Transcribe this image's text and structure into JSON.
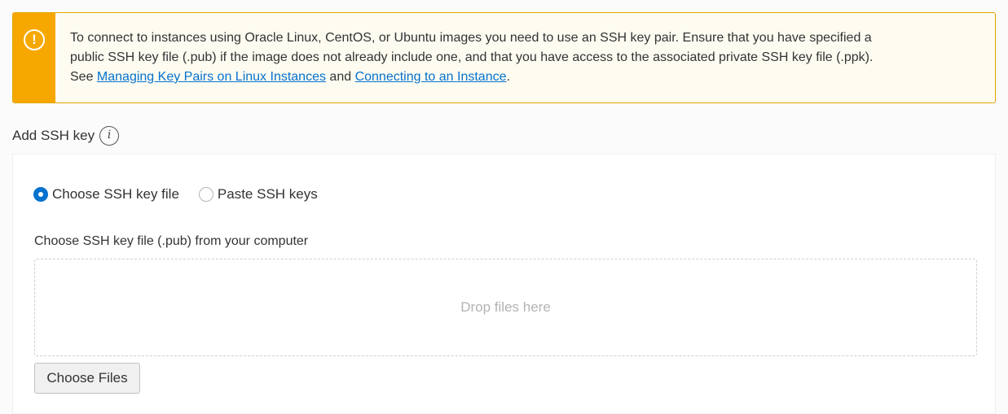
{
  "notice": {
    "icon": "warning-circle-icon",
    "line1": "To connect to instances using Oracle Linux, CentOS, or Ubuntu images you need to use an SSH key pair. Ensure that you have specified a",
    "line2": "public SSH key file (.pub) if the image does not already include one, and that you have access to the associated private SSH key file (.ppk).",
    "see": "See ",
    "link1": "Managing Key Pairs on Linux Instances",
    "and": " and ",
    "link2": "Connecting to an Instance",
    "period": ".",
    "accent_color": "#f6a800",
    "link_color": "#0572ce"
  },
  "ssh": {
    "section_label": "Add SSH key",
    "info_icon_glyph": "i",
    "options": [
      {
        "label": "Choose SSH key file",
        "selected": true
      },
      {
        "label": "Paste SSH keys",
        "selected": false
      }
    ],
    "file_label": "Choose SSH key file (.pub) from your computer",
    "dropzone_text": "Drop files here",
    "choose_button": "Choose Files"
  }
}
